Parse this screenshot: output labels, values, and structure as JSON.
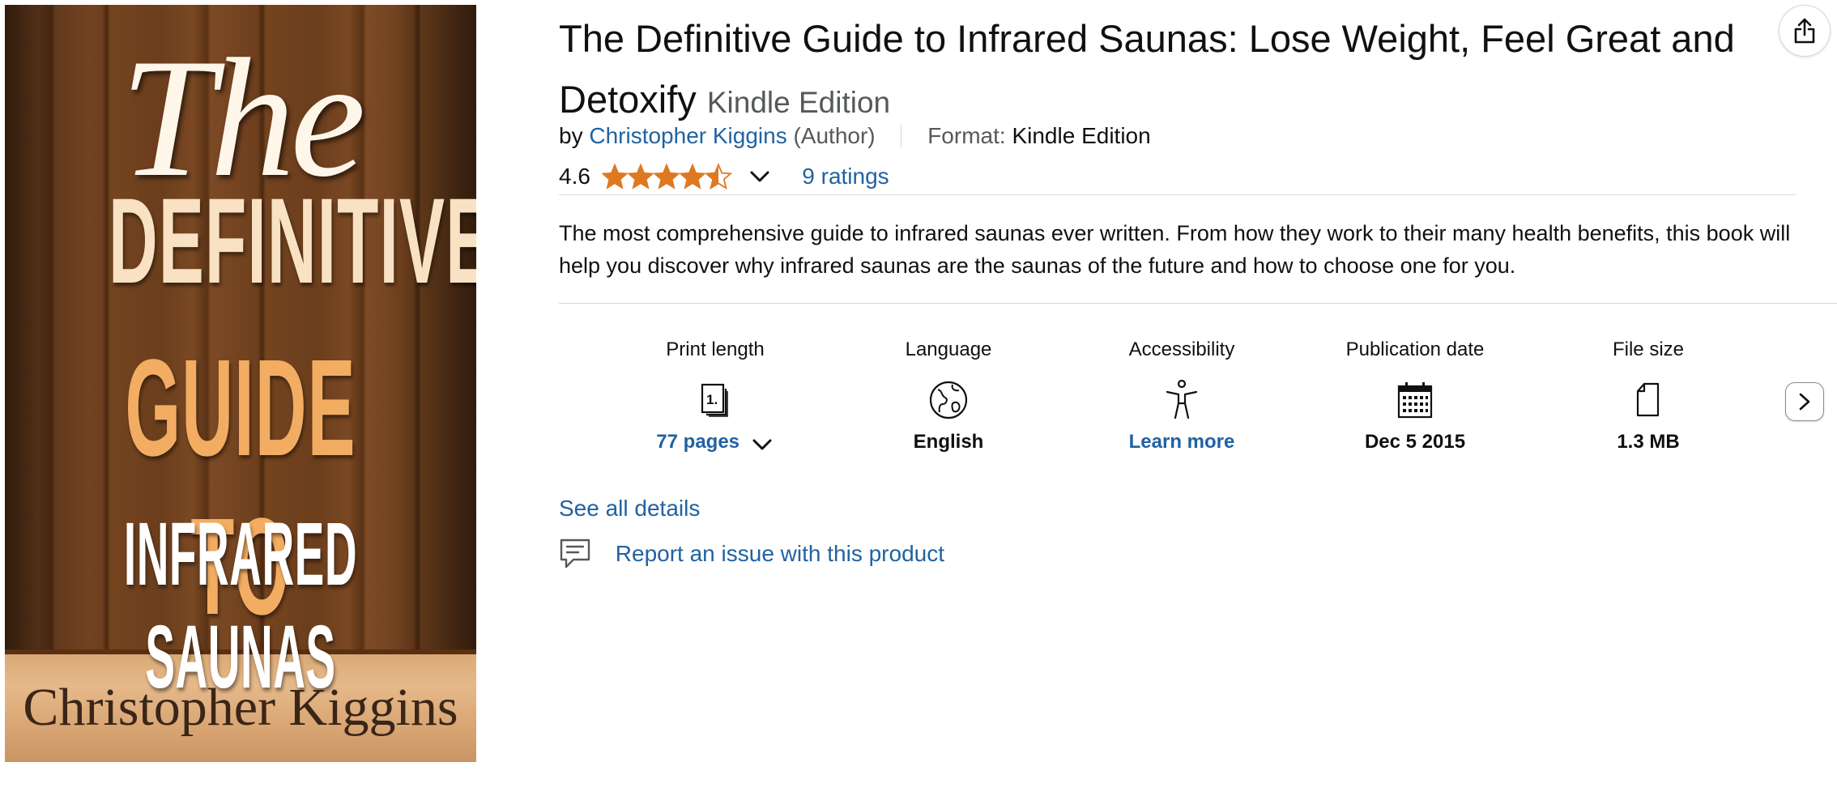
{
  "cover": {
    "the": "The",
    "line1": "DEFINITIVE",
    "line2": "GUIDE TO",
    "line3": "INFRARED SAUNAS",
    "author": "Christopher Kiggins"
  },
  "product": {
    "title": "The Definitive Guide to Infrared Saunas: Lose Weight, Feel Great and Detoxify",
    "edition": "Kindle Edition",
    "by_label": "by",
    "author": "Christopher Kiggins",
    "author_role": "(Author)",
    "format_label": "Format:",
    "format_value": "Kindle Edition",
    "rating": "4.6",
    "rating_fraction": 0.92,
    "ratings_count": "9 ratings",
    "description": "The most comprehensive guide to infrared saunas ever written. From how they work to their many health benefits, this book will help you discover why infrared saunas are the saunas of the future and how to choose one for you."
  },
  "attributes": [
    {
      "label": "Print length",
      "value": "77 pages",
      "icon": "book-pages-icon"
    },
    {
      "label": "Language",
      "value": "English",
      "icon": "globe-icon"
    },
    {
      "label": "Accessibility",
      "value": "Learn more",
      "icon": "accessibility-icon"
    },
    {
      "label": "Publication date",
      "value": "Dec 5 2015",
      "icon": "calendar-icon"
    },
    {
      "label": "File size",
      "value": "1.3 MB",
      "icon": "file-icon"
    }
  ],
  "links": {
    "see_all": "See all details",
    "report": "Report an issue with this product"
  },
  "colors": {
    "link": "#2162a1",
    "star": "#de7921",
    "text": "#0f1111",
    "muted": "#565959",
    "divider": "#d5d9d9"
  }
}
